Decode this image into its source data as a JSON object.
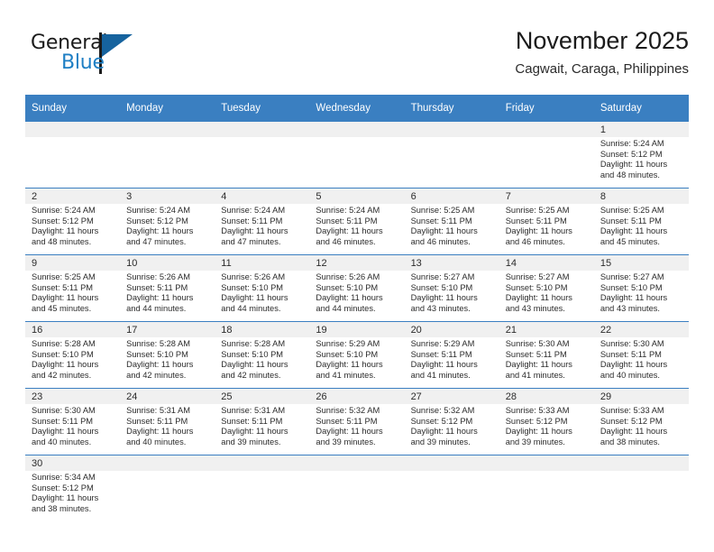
{
  "brand": {
    "name_part1": "General",
    "name_part2": "Blue"
  },
  "header": {
    "title": "November 2025",
    "subtitle": "Cagwait, Caraga, Philippines"
  },
  "colors": {
    "header_blue": "#3a7fc1",
    "logo_blue": "#1f7fc4",
    "band_gray": "#f0f0f0"
  },
  "weekdays": [
    "Sunday",
    "Monday",
    "Tuesday",
    "Wednesday",
    "Thursday",
    "Friday",
    "Saturday"
  ],
  "labels": {
    "sunrise": "Sunrise:",
    "sunset": "Sunset:",
    "daylight": "Daylight:"
  },
  "weeks": [
    [
      {
        "day": "",
        "empty": true
      },
      {
        "day": "",
        "empty": true
      },
      {
        "day": "",
        "empty": true
      },
      {
        "day": "",
        "empty": true
      },
      {
        "day": "",
        "empty": true
      },
      {
        "day": "",
        "empty": true
      },
      {
        "day": "1",
        "sunrise": "Sunrise: 5:24 AM",
        "sunset": "Sunset: 5:12 PM",
        "daylight1": "Daylight: 11 hours",
        "daylight2": "and 48 minutes."
      }
    ],
    [
      {
        "day": "2",
        "sunrise": "Sunrise: 5:24 AM",
        "sunset": "Sunset: 5:12 PM",
        "daylight1": "Daylight: 11 hours",
        "daylight2": "and 48 minutes."
      },
      {
        "day": "3",
        "sunrise": "Sunrise: 5:24 AM",
        "sunset": "Sunset: 5:12 PM",
        "daylight1": "Daylight: 11 hours",
        "daylight2": "and 47 minutes."
      },
      {
        "day": "4",
        "sunrise": "Sunrise: 5:24 AM",
        "sunset": "Sunset: 5:11 PM",
        "daylight1": "Daylight: 11 hours",
        "daylight2": "and 47 minutes."
      },
      {
        "day": "5",
        "sunrise": "Sunrise: 5:24 AM",
        "sunset": "Sunset: 5:11 PM",
        "daylight1": "Daylight: 11 hours",
        "daylight2": "and 46 minutes."
      },
      {
        "day": "6",
        "sunrise": "Sunrise: 5:25 AM",
        "sunset": "Sunset: 5:11 PM",
        "daylight1": "Daylight: 11 hours",
        "daylight2": "and 46 minutes."
      },
      {
        "day": "7",
        "sunrise": "Sunrise: 5:25 AM",
        "sunset": "Sunset: 5:11 PM",
        "daylight1": "Daylight: 11 hours",
        "daylight2": "and 46 minutes."
      },
      {
        "day": "8",
        "sunrise": "Sunrise: 5:25 AM",
        "sunset": "Sunset: 5:11 PM",
        "daylight1": "Daylight: 11 hours",
        "daylight2": "and 45 minutes."
      }
    ],
    [
      {
        "day": "9",
        "sunrise": "Sunrise: 5:25 AM",
        "sunset": "Sunset: 5:11 PM",
        "daylight1": "Daylight: 11 hours",
        "daylight2": "and 45 minutes."
      },
      {
        "day": "10",
        "sunrise": "Sunrise: 5:26 AM",
        "sunset": "Sunset: 5:11 PM",
        "daylight1": "Daylight: 11 hours",
        "daylight2": "and 44 minutes."
      },
      {
        "day": "11",
        "sunrise": "Sunrise: 5:26 AM",
        "sunset": "Sunset: 5:10 PM",
        "daylight1": "Daylight: 11 hours",
        "daylight2": "and 44 minutes."
      },
      {
        "day": "12",
        "sunrise": "Sunrise: 5:26 AM",
        "sunset": "Sunset: 5:10 PM",
        "daylight1": "Daylight: 11 hours",
        "daylight2": "and 44 minutes."
      },
      {
        "day": "13",
        "sunrise": "Sunrise: 5:27 AM",
        "sunset": "Sunset: 5:10 PM",
        "daylight1": "Daylight: 11 hours",
        "daylight2": "and 43 minutes."
      },
      {
        "day": "14",
        "sunrise": "Sunrise: 5:27 AM",
        "sunset": "Sunset: 5:10 PM",
        "daylight1": "Daylight: 11 hours",
        "daylight2": "and 43 minutes."
      },
      {
        "day": "15",
        "sunrise": "Sunrise: 5:27 AM",
        "sunset": "Sunset: 5:10 PM",
        "daylight1": "Daylight: 11 hours",
        "daylight2": "and 43 minutes."
      }
    ],
    [
      {
        "day": "16",
        "sunrise": "Sunrise: 5:28 AM",
        "sunset": "Sunset: 5:10 PM",
        "daylight1": "Daylight: 11 hours",
        "daylight2": "and 42 minutes."
      },
      {
        "day": "17",
        "sunrise": "Sunrise: 5:28 AM",
        "sunset": "Sunset: 5:10 PM",
        "daylight1": "Daylight: 11 hours",
        "daylight2": "and 42 minutes."
      },
      {
        "day": "18",
        "sunrise": "Sunrise: 5:28 AM",
        "sunset": "Sunset: 5:10 PM",
        "daylight1": "Daylight: 11 hours",
        "daylight2": "and 42 minutes."
      },
      {
        "day": "19",
        "sunrise": "Sunrise: 5:29 AM",
        "sunset": "Sunset: 5:10 PM",
        "daylight1": "Daylight: 11 hours",
        "daylight2": "and 41 minutes."
      },
      {
        "day": "20",
        "sunrise": "Sunrise: 5:29 AM",
        "sunset": "Sunset: 5:11 PM",
        "daylight1": "Daylight: 11 hours",
        "daylight2": "and 41 minutes."
      },
      {
        "day": "21",
        "sunrise": "Sunrise: 5:30 AM",
        "sunset": "Sunset: 5:11 PM",
        "daylight1": "Daylight: 11 hours",
        "daylight2": "and 41 minutes."
      },
      {
        "day": "22",
        "sunrise": "Sunrise: 5:30 AM",
        "sunset": "Sunset: 5:11 PM",
        "daylight1": "Daylight: 11 hours",
        "daylight2": "and 40 minutes."
      }
    ],
    [
      {
        "day": "23",
        "sunrise": "Sunrise: 5:30 AM",
        "sunset": "Sunset: 5:11 PM",
        "daylight1": "Daylight: 11 hours",
        "daylight2": "and 40 minutes."
      },
      {
        "day": "24",
        "sunrise": "Sunrise: 5:31 AM",
        "sunset": "Sunset: 5:11 PM",
        "daylight1": "Daylight: 11 hours",
        "daylight2": "and 40 minutes."
      },
      {
        "day": "25",
        "sunrise": "Sunrise: 5:31 AM",
        "sunset": "Sunset: 5:11 PM",
        "daylight1": "Daylight: 11 hours",
        "daylight2": "and 39 minutes."
      },
      {
        "day": "26",
        "sunrise": "Sunrise: 5:32 AM",
        "sunset": "Sunset: 5:11 PM",
        "daylight1": "Daylight: 11 hours",
        "daylight2": "and 39 minutes."
      },
      {
        "day": "27",
        "sunrise": "Sunrise: 5:32 AM",
        "sunset": "Sunset: 5:12 PM",
        "daylight1": "Daylight: 11 hours",
        "daylight2": "and 39 minutes."
      },
      {
        "day": "28",
        "sunrise": "Sunrise: 5:33 AM",
        "sunset": "Sunset: 5:12 PM",
        "daylight1": "Daylight: 11 hours",
        "daylight2": "and 39 minutes."
      },
      {
        "day": "29",
        "sunrise": "Sunrise: 5:33 AM",
        "sunset": "Sunset: 5:12 PM",
        "daylight1": "Daylight: 11 hours",
        "daylight2": "and 38 minutes."
      }
    ],
    [
      {
        "day": "30",
        "sunrise": "Sunrise: 5:34 AM",
        "sunset": "Sunset: 5:12 PM",
        "daylight1": "Daylight: 11 hours",
        "daylight2": "and 38 minutes."
      },
      {
        "day": "",
        "empty": true
      },
      {
        "day": "",
        "empty": true
      },
      {
        "day": "",
        "empty": true
      },
      {
        "day": "",
        "empty": true
      },
      {
        "day": "",
        "empty": true
      },
      {
        "day": "",
        "empty": true
      }
    ]
  ]
}
